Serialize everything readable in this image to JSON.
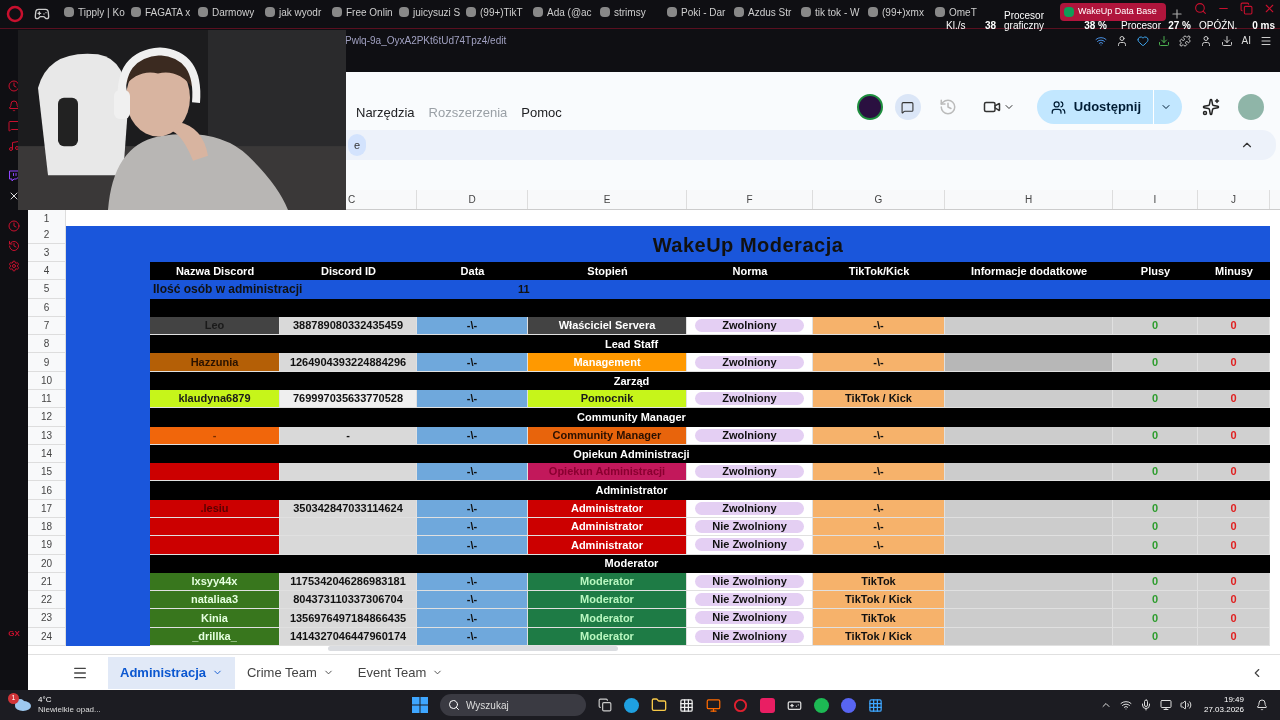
{
  "browser": {
    "tabs": [
      {
        "label": "Tipply | Ko",
        "selected": false
      },
      {
        "label": "FAGATA x",
        "selected": false
      },
      {
        "label": "Darmowy",
        "selected": false
      },
      {
        "label": "jak wyodr",
        "selected": false
      },
      {
        "label": "Free Onlin",
        "selected": false
      },
      {
        "label": "juicysuzi S",
        "selected": false
      },
      {
        "label": "(99+)TikT",
        "selected": false
      },
      {
        "label": "Ada (@ac",
        "selected": false
      },
      {
        "label": "strimsy",
        "selected": false
      },
      {
        "label": "Poki - Dar",
        "selected": false
      },
      {
        "label": "Azdus Str",
        "selected": false
      },
      {
        "label": "tik tok - W",
        "selected": false
      },
      {
        "label": "(99+)xmx",
        "selected": false
      },
      {
        "label": "OmeT",
        "selected": false
      },
      {
        "label": "WakeUp Data Base",
        "selected": true
      }
    ],
    "url": "Pwlq-9a_OyxA2PKt6tUd74Tpz4/edit",
    "stats": [
      {
        "label": "Kl./s",
        "value": "38"
      },
      {
        "label": "Procesor graficzny",
        "value": "38 %"
      },
      {
        "label": "Procesor",
        "value": "27 %"
      },
      {
        "label": "OPÓŹN.",
        "value": "0 ms"
      }
    ],
    "ai_label": "AI",
    "sidebar_logo": "GX"
  },
  "sheets": {
    "menu": [
      {
        "label": "Narzędzia",
        "disabled": false
      },
      {
        "label": "Rozszerzenia",
        "disabled": true
      },
      {
        "label": "Pomoc",
        "disabled": false
      }
    ],
    "share": "Udostępnij",
    "chip": "e",
    "columns": [
      "C",
      "D",
      "E",
      "F",
      "G",
      "H",
      "I",
      "J"
    ],
    "title": "WakeUp Moderacja",
    "title_rows": [
      "2",
      "3"
    ],
    "first_row": "1",
    "header_row": {
      "num": "4",
      "labels": [
        "Nazwa Discord",
        "Discord ID",
        "Data",
        "Stopień",
        "Norma",
        "TikTok/Kick",
        "Informacje dodatkowe",
        "Plusy",
        "Minusy"
      ]
    },
    "count_row": {
      "num": "5",
      "label": "Ilość osób w administracji",
      "value": "11"
    },
    "rows": [
      {
        "num": "6",
        "kind": "band"
      },
      {
        "num": "7",
        "kind": "owner",
        "name": "Leo",
        "id": "388789080332435459",
        "date": "-\\-",
        "rank": "Właściciel Servera",
        "norma": "Zwolniony",
        "tiktok": "-\\-",
        "plus": "0",
        "minus": "0"
      },
      {
        "num": "8",
        "kind": "section",
        "label": "Lead Staff"
      },
      {
        "num": "9",
        "kind": "management",
        "name": "Hazzunia",
        "id": "1264904393224884296",
        "date": "-\\-",
        "rank": "Management",
        "norma": "Zwolniony",
        "tiktok": "-\\-",
        "plus": "0",
        "minus": "0"
      },
      {
        "num": "10",
        "kind": "section",
        "label": "Zarząd"
      },
      {
        "num": "11",
        "kind": "helper",
        "name": "klaudyna6879",
        "id": "769997035633770528",
        "date": "-\\-",
        "rank": "Pomocnik",
        "norma": "Zwolniony",
        "tiktok": "TikTok / Kick",
        "plus": "0",
        "minus": "0"
      },
      {
        "num": "12",
        "kind": "section",
        "label": "Community Manager"
      },
      {
        "num": "13",
        "kind": "community",
        "name": "-",
        "id": "-",
        "date": "-\\-",
        "rank": "Community Manager",
        "norma": "Zwolniony",
        "tiktok": "-\\-",
        "plus": "0",
        "minus": "0"
      },
      {
        "num": "14",
        "kind": "section",
        "label": "Opiekun Administracji"
      },
      {
        "num": "15",
        "kind": "guardian",
        "date": "-\\-",
        "rank": "Opiekun Administracji",
        "norma": "Zwolniony",
        "tiktok": "-\\-",
        "plus": "0",
        "minus": "0"
      },
      {
        "num": "16",
        "kind": "section",
        "label": "Administrator"
      },
      {
        "num": "17",
        "kind": "admin",
        "name": ".lesiu",
        "id": "350342847033114624",
        "date": "-\\-",
        "rank": "Administrator",
        "norma": "Zwolniony",
        "tiktok": "-\\-",
        "plus": "0",
        "minus": "0"
      },
      {
        "num": "18",
        "kind": "admin",
        "date": "-\\-",
        "rank": "Administrator",
        "norma": "Nie Zwolniony",
        "tiktok": "-\\-",
        "plus": "0",
        "minus": "0"
      },
      {
        "num": "19",
        "kind": "admin",
        "date": "-\\-",
        "rank": "Administrator",
        "norma": "Nie Zwolniony",
        "tiktok": "-\\-",
        "plus": "0",
        "minus": "0"
      },
      {
        "num": "20",
        "kind": "section",
        "label": "Moderator"
      },
      {
        "num": "21",
        "kind": "moderator",
        "name": "lxsyy44x",
        "id": "1175342046286983181",
        "date": "-\\-",
        "rank": "Moderator",
        "norma": "Nie Zwolniony",
        "tiktok": "TikTok",
        "plus": "0",
        "minus": "0"
      },
      {
        "num": "22",
        "kind": "moderator",
        "name": "nataliaa3",
        "id": "804373110337306704",
        "date": "-\\-",
        "rank": "Moderator",
        "norma": "Nie Zwolniony",
        "tiktok": "TikTok / Kick",
        "plus": "0",
        "minus": "0"
      },
      {
        "num": "23",
        "kind": "moderator",
        "name": "Kinia",
        "id": "1356976497184866435",
        "date": "-\\-",
        "rank": "Moderator",
        "norma": "Nie Zwolniony",
        "tiktok": "TikTok",
        "plus": "0",
        "minus": "0"
      },
      {
        "num": "24",
        "kind": "moderator",
        "name": "_drillka_",
        "id": "1414327046447960174",
        "date": "-\\-",
        "rank": "Moderator",
        "norma": "Nie Zwolniony",
        "tiktok": "TikTok / Kick",
        "plus": "0",
        "minus": "0"
      }
    ],
    "sheet_tabs": [
      {
        "label": "Administracja",
        "selected": true
      },
      {
        "label": "Crime Team",
        "selected": false
      },
      {
        "label": "Event Team",
        "selected": false
      }
    ]
  },
  "taskbar": {
    "weather_temp": "4°C",
    "weather_text": "Niewielkie opad...",
    "weather_badge": "1",
    "search": "Wyszukaj",
    "time": "19:49",
    "date": "27.03.2026"
  }
}
